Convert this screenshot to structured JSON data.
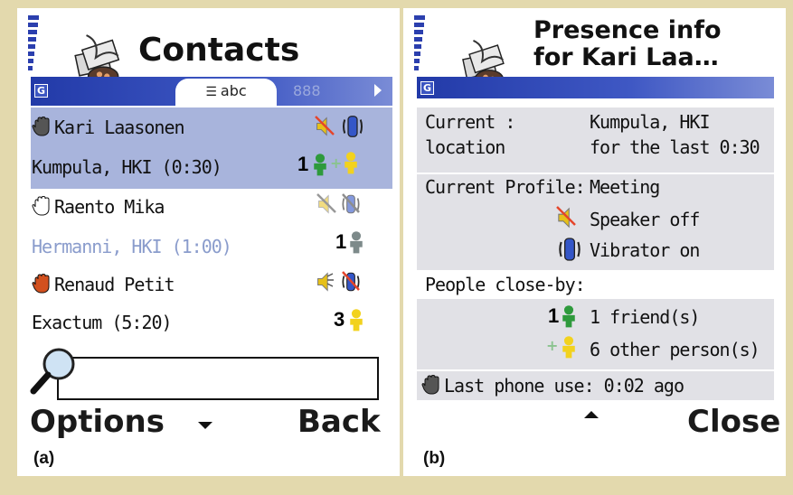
{
  "panel_a": {
    "title": "Contacts",
    "tab_label": "abc",
    "tab_other": "888",
    "contacts": [
      {
        "name": "Kari Laasonen",
        "location": "Kumpula, HKI (0:30)",
        "count": "1"
      },
      {
        "name": "Raento Mika",
        "location": "Hermanni, HKI (1:00)",
        "count": "1"
      },
      {
        "name": "Renaud Petit",
        "location": "Exactum (5:20)",
        "count": "3"
      }
    ],
    "search_value": "",
    "softkey_left": "Options",
    "softkey_right": "Back",
    "caption": "(a)"
  },
  "panel_b": {
    "title_line1": "Presence info",
    "title_line2": "for  Kari Laa…",
    "location_label_1": "Current :",
    "location_label_2": "location",
    "location_value_1": "Kumpula, HKI",
    "location_value_2": "for the last 0:30",
    "profile_label": "Current Profile:",
    "profile_value": "Meeting",
    "speaker_status": "Speaker off",
    "vibrator_status": "Vibrator on",
    "people_label": "People close-by:",
    "friends_count": "1",
    "friends_text": "1 friend(s)",
    "others_text": "6 other person(s)",
    "last_phone_use": "Last phone use: 0:02 ago",
    "softkey_right": "Close",
    "caption": "(b)"
  },
  "colors": {
    "frame": "#e3d9ad",
    "highlight": "#a8b4dc",
    "header_blue": "#223aa8",
    "hand_red": "#d2501e",
    "friend_green": "#2e9a3c",
    "person_yellow": "#f2d21e"
  },
  "icons": [
    "signal-icon",
    "contacts-logo-icon",
    "hand-icon",
    "speaker-off-icon",
    "vibrator-on-icon",
    "friend-icon",
    "person-icon",
    "search-icon"
  ]
}
